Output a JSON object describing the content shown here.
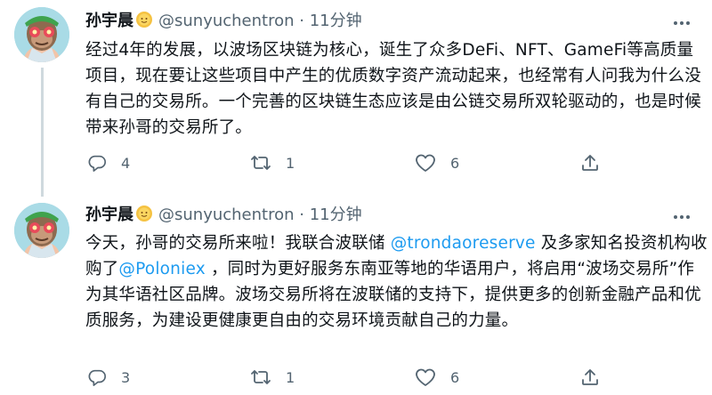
{
  "tweets": [
    {
      "author_name": "孙宇晨",
      "handle": "@sunyuchentron",
      "separator": "·",
      "time": "11分钟",
      "text_segments": [
        {
          "type": "text",
          "value": "经过4年的发展，以波场区块链为核心，诞生了众多DeFi、NFT、GameFi等高质量项目，现在要让这些项目中产生的优质数字资产流动起来，也经常有人问我为什么没有自己的交易所。一个完善的区块链生态应该是由公链交易所双轮驱动的，也是时候带来孙哥的交易所了。"
        }
      ],
      "replies": "4",
      "retweets": "1",
      "likes": "6"
    },
    {
      "author_name": "孙宇晨",
      "handle": "@sunyuchentron",
      "separator": "·",
      "time": "11分钟",
      "text_segments": [
        {
          "type": "text",
          "value": "今天，孙哥的交易所来啦！我联合波联储 "
        },
        {
          "type": "mention",
          "value": "@trondaoreserve"
        },
        {
          "type": "text",
          "value": " 及多家知名投资机构收购了"
        },
        {
          "type": "mention",
          "value": "@Poloniex"
        },
        {
          "type": "text",
          "value": " ，同时为更好服务东南亚等地的华语用户，将启用“波场交易所”作为其华语社区品牌。波场交易所将在波联储的支持下，提供更多的创新金融产品和优质服务，为建设更健康更自由的交易环境贡献自己的力量。"
        }
      ],
      "replies": "3",
      "retweets": "1",
      "likes": "6"
    }
  ],
  "icons": {
    "author_badge": "sun-emoji-icon",
    "more": "more-options-icon",
    "reply": "reply-icon",
    "retweet": "retweet-icon",
    "like": "like-icon",
    "share": "share-icon"
  },
  "colors": {
    "link": "#1d9bf0",
    "muted": "#536471",
    "thread_line": "#cfd9de",
    "avatar_bg": "#a9dbe6"
  }
}
